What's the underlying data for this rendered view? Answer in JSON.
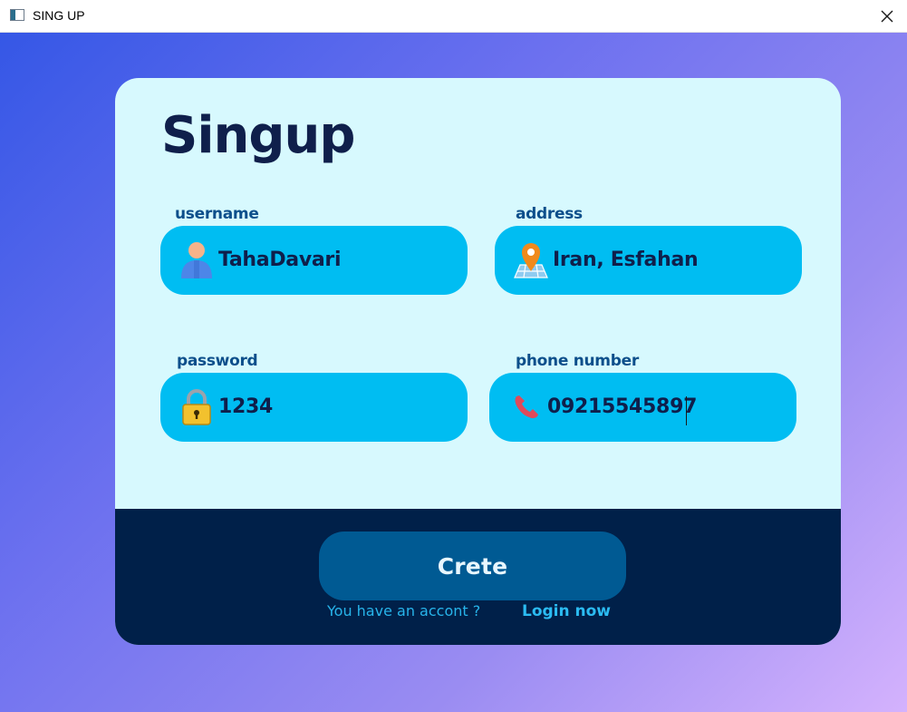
{
  "window": {
    "title": "SING UP",
    "icons": {
      "app": "window-app-icon",
      "close": "close-icon"
    }
  },
  "form": {
    "heading": "Singup",
    "fields": {
      "username": {
        "label": "username",
        "value": "TahaDavari",
        "icon": "user-icon"
      },
      "address": {
        "label": "address",
        "value": "Iran, Esfahan",
        "icon": "map-pin-icon"
      },
      "password": {
        "label": "password",
        "value": "1234",
        "icon": "lock-icon"
      },
      "phone": {
        "label": "phone number",
        "value": "09215545897",
        "icon": "phone-icon"
      }
    }
  },
  "footer": {
    "submit_label": "Crete",
    "prompt": "You have an accont ?",
    "login_label": "Login now"
  },
  "colors": {
    "card_bg": "#d7f9fe",
    "field_bg": "#00bdf2",
    "footer_bg": "#002049",
    "button_bg": "#005a93",
    "heading_text": "#0f1f4b",
    "label_text": "#0d4f8b",
    "link_text": "#2bbcf2"
  }
}
